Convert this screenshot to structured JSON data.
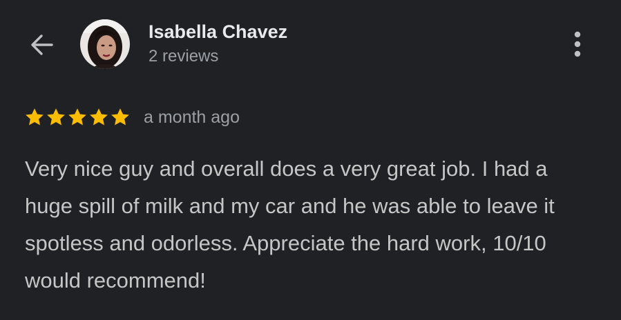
{
  "header": {
    "back_icon": "arrow-left-icon",
    "user_name": "Isabella Chavez",
    "review_count": "2 reviews",
    "more_icon": "more-vertical-icon"
  },
  "review": {
    "rating": 5,
    "rating_max": 5,
    "time": "a month ago",
    "text": "Very nice guy and overall does a very great job. I had a huge spill of milk and my car and he was able to leave it spotless and odorless. Appreciate the hard work, 10/10 would recommend!"
  },
  "colors": {
    "background": "#202124",
    "star": "#fbbc04",
    "primary_text": "#e8eaed",
    "secondary_text": "#9aa0a6",
    "body_text": "#c4c7c5"
  }
}
